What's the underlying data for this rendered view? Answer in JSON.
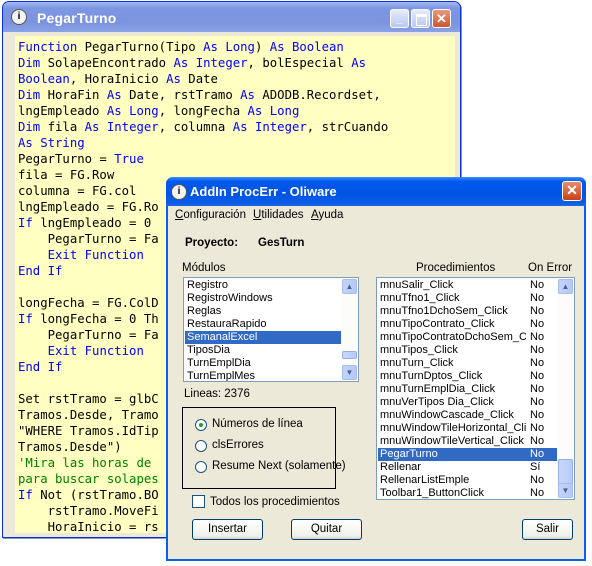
{
  "back_window": {
    "title": "PegarTurno",
    "icon": "info-icon",
    "controls": {
      "minimize": "minimize-icon",
      "maximize": "maximize-icon",
      "close": "close-icon"
    },
    "code_lines": [
      [
        [
          "kw",
          "Function"
        ],
        [
          "t",
          " PegarTurno(Tipo "
        ],
        [
          "kw",
          "As"
        ],
        [
          "t",
          " "
        ],
        [
          "kw",
          "Long"
        ],
        [
          "t",
          ") "
        ],
        [
          "kw",
          "As"
        ],
        [
          "t",
          " "
        ],
        [
          "kw",
          "Boolean"
        ]
      ],
      [
        [
          "kw",
          "Dim"
        ],
        [
          "t",
          " SolapeEncontrado "
        ],
        [
          "kw",
          "As"
        ],
        [
          "t",
          " "
        ],
        [
          "kw",
          "Integer"
        ],
        [
          "t",
          ", bolEspecial "
        ],
        [
          "kw",
          "As"
        ]
      ],
      [
        [
          "kw",
          "Boolean"
        ],
        [
          "t",
          ", HoraInicio "
        ],
        [
          "kw",
          "As"
        ],
        [
          "t",
          " Date"
        ]
      ],
      [
        [
          "kw",
          "Dim"
        ],
        [
          "t",
          " HoraFin "
        ],
        [
          "kw",
          "As"
        ],
        [
          "t",
          " Date, rstTramo "
        ],
        [
          "kw",
          "As"
        ],
        [
          "t",
          " ADODB.Recordset,"
        ]
      ],
      [
        [
          "t",
          "lngEmpleado "
        ],
        [
          "kw",
          "As"
        ],
        [
          "t",
          " "
        ],
        [
          "kw",
          "Long"
        ],
        [
          "t",
          ", longFecha "
        ],
        [
          "kw",
          "As"
        ],
        [
          "t",
          " "
        ],
        [
          "kw",
          "Long"
        ]
      ],
      [
        [
          "kw",
          "Dim"
        ],
        [
          "t",
          " fila "
        ],
        [
          "kw",
          "As"
        ],
        [
          "t",
          " "
        ],
        [
          "kw",
          "Integer"
        ],
        [
          "t",
          ", columna "
        ],
        [
          "kw",
          "As"
        ],
        [
          "t",
          " "
        ],
        [
          "kw",
          "Integer"
        ],
        [
          "t",
          ", strCuando"
        ]
      ],
      [
        [
          "kw",
          "As"
        ],
        [
          "t",
          " "
        ],
        [
          "kw",
          "String"
        ]
      ],
      [
        [
          "t",
          "PegarTurno = "
        ],
        [
          "kw",
          "True"
        ]
      ],
      [
        [
          "t",
          "fila = FG.Row"
        ]
      ],
      [
        [
          "t",
          "columna = FG.col"
        ]
      ],
      [
        [
          "t",
          "lngEmpleado = FG.Ro"
        ]
      ],
      [
        [
          "kw",
          "If"
        ],
        [
          "t",
          " lngEmpleado = 0 "
        ]
      ],
      [
        [
          "t",
          "    PegarTurno = Fa"
        ]
      ],
      [
        [
          "t",
          "    "
        ],
        [
          "kw",
          "Exit Function"
        ]
      ],
      [
        [
          "kw",
          "End If"
        ]
      ],
      [
        [
          "t",
          ""
        ]
      ],
      [
        [
          "t",
          "longFecha = FG.ColD"
        ]
      ],
      [
        [
          "kw",
          "If"
        ],
        [
          "t",
          " longFecha = 0 Th"
        ]
      ],
      [
        [
          "t",
          "    PegarTurno = Fa"
        ]
      ],
      [
        [
          "t",
          "    "
        ],
        [
          "kw",
          "Exit Function"
        ]
      ],
      [
        [
          "kw",
          "End If"
        ]
      ],
      [
        [
          "t",
          ""
        ]
      ],
      [
        [
          "t",
          "Set rstTramo = glbC"
        ]
      ],
      [
        [
          "t",
          "Tramos.Desde, Tramo"
        ]
      ],
      [
        [
          "t",
          "\"WHERE Tramos.IdTip"
        ]
      ],
      [
        [
          "t",
          "Tramos.Desde\")"
        ]
      ],
      [
        [
          "cm",
          "'Mira las horas de "
        ]
      ],
      [
        [
          "cm",
          "para buscar solapes"
        ]
      ],
      [
        [
          "kw",
          "If"
        ],
        [
          "t",
          " Not (rstTramo.BO"
        ]
      ],
      [
        [
          "t",
          "    rstTramo.MoveFi"
        ]
      ],
      [
        [
          "t",
          "    HoraInicio = rs"
        ]
      ]
    ]
  },
  "dialog": {
    "title": "AddIn ProcErr - Oliware",
    "close_icon": "close-icon",
    "menu": [
      {
        "label": "Configuración",
        "mnemonic": "C"
      },
      {
        "label": "Utilidades",
        "mnemonic": "U"
      },
      {
        "label": "Ayuda",
        "mnemonic": "A"
      }
    ],
    "project_label": "Proyecto:",
    "project_name": "GesTurn",
    "modules_label": "Módulos",
    "modules": [
      "Registro",
      "RegistroWindows",
      "Reglas",
      "RestauraRapido",
      "SemanalExcel",
      "TiposDia",
      "TurnEmplDia",
      "TurnEmplMes"
    ],
    "modules_selected": "SemanalExcel",
    "lines_text": "Lineas: 2376",
    "procedures_label": "Procedimientos",
    "on_error_label": "On Error",
    "procedures": [
      [
        "mnuSalir_Click",
        "No"
      ],
      [
        "mnuTfno1_Click",
        "No"
      ],
      [
        "mnuTfno1DchoSem_Click",
        "No"
      ],
      [
        "mnuTipoContrato_Click",
        "No"
      ],
      [
        "mnuTipoContratoDchoSem_Clic",
        "No"
      ],
      [
        "mnuTipos_Click",
        "No"
      ],
      [
        "mnuTurn_Click",
        "No"
      ],
      [
        "mnuTurnDptos_Click",
        "No"
      ],
      [
        "mnuTurnEmplDia_Click",
        "No"
      ],
      [
        "mnuVerTipos Dia_Click",
        "No"
      ],
      [
        "mnuWindowCascade_Click",
        "No"
      ],
      [
        "mnuWindowTileHorizontal_Clic",
        "No"
      ],
      [
        "mnuWindowTileVertical_Click",
        "No"
      ],
      [
        "PegarTurno",
        "No"
      ],
      [
        "Rellenar",
        "Sí"
      ],
      [
        "RellenarListEmple",
        "No"
      ],
      [
        "Toolbar1_ButtonClick",
        "No"
      ]
    ],
    "procedures_selected": "PegarTurno",
    "radio_options": [
      "Números de línea",
      "clsErrores",
      "Resume Next (solamente)"
    ],
    "radio_selected": "Números de línea",
    "checkbox_label": "Todos los procedimientos",
    "checkbox_checked": false,
    "buttons": {
      "insert": "Insertar",
      "remove": "Quitar",
      "exit": "Salir"
    }
  },
  "colors": {
    "code_background": "#ffffc1",
    "keyword": "#0000ff",
    "comment": "#008000",
    "selection": "#316ac5"
  }
}
